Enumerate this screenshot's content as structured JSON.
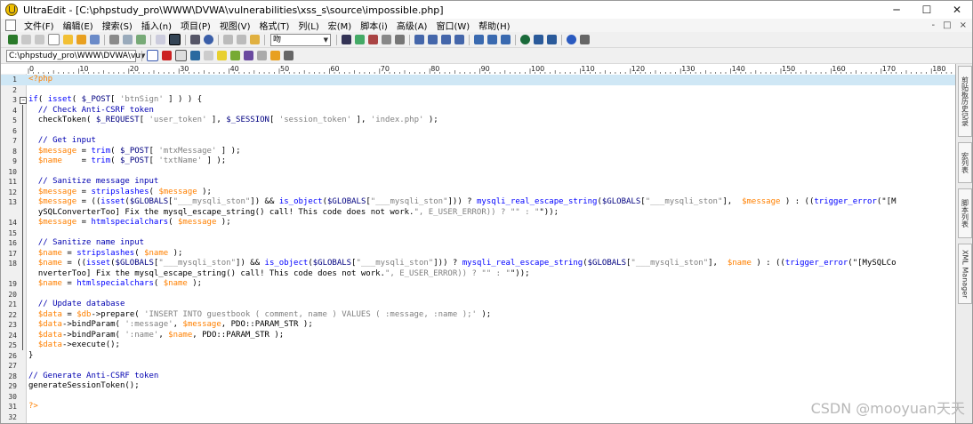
{
  "window": {
    "title": "UltraEdit - [C:\\phpstudy_pro\\WWW\\DVWA\\vulnerabilities\\xss_s\\source\\impossible.php]"
  },
  "menu": {
    "items": [
      "文件(F)",
      "编辑(E)",
      "搜索(S)",
      "插入(n)",
      "项目(P)",
      "视图(V)",
      "格式(T)",
      "列(L)",
      "宏(M)",
      "脚本(i)",
      "高级(A)",
      "窗口(W)",
      "帮助(H)"
    ],
    "right_controls": [
      "-",
      "□",
      "×"
    ]
  },
  "toolbar": {
    "font_combo": "吻"
  },
  "toolbar2": {
    "path_combo": "C:\\phpstudy_pro\\WWW\\DVWA\\vu"
  },
  "ruler": {
    "marks": [
      "0",
      "10",
      "20",
      "30",
      "40",
      "50",
      "60",
      "70",
      "80",
      "90",
      "100",
      "110",
      "120",
      "130",
      "140",
      "150",
      "160",
      "170",
      "180"
    ]
  },
  "side_tabs": [
    "剪贴板历史记录",
    "宏列表",
    "脚本列表",
    "XML Manager"
  ],
  "watermark": "CSDN @mooyuan天天",
  "code": {
    "lines": [
      {
        "n": "1",
        "text": "<?php"
      },
      {
        "n": "2",
        "text": ""
      },
      {
        "n": "3",
        "text": "if( isset( $_POST[ 'btnSign' ] ) ) {"
      },
      {
        "n": "4",
        "text": "  // Check Anti-CSRF token"
      },
      {
        "n": "5",
        "text": "  checkToken( $_REQUEST[ 'user_token' ], $_SESSION[ 'session_token' ], 'index.php' );"
      },
      {
        "n": "6",
        "text": ""
      },
      {
        "n": "7",
        "text": "  // Get input"
      },
      {
        "n": "8",
        "text": "  $message = trim( $_POST[ 'mtxMessage' ] );"
      },
      {
        "n": "9",
        "text": "  $name    = trim( $_POST[ 'txtName' ] );"
      },
      {
        "n": "10",
        "text": ""
      },
      {
        "n": "11",
        "text": "  // Sanitize message input"
      },
      {
        "n": "12",
        "text": "  $message = stripslashes( $message );"
      },
      {
        "n": "13",
        "text": "  $message = ((isset($GLOBALS[\"___mysqli_ston\"]) && is_object($GLOBALS[\"___mysqli_ston\"])) ? mysqli_real_escape_string($GLOBALS[\"___mysqli_ston\"],  $message ) : ((trigger_error(\"[M"
      },
      {
        "n": "",
        "text": "  ySQLConverterToo] Fix the mysql_escape_string() call! This code does not work.\", E_USER_ERROR)) ? \"\" : \"\"));"
      },
      {
        "n": "14",
        "text": "  $message = htmlspecialchars( $message );"
      },
      {
        "n": "15",
        "text": ""
      },
      {
        "n": "16",
        "text": "  // Sanitize name input"
      },
      {
        "n": "17",
        "text": "  $name = stripslashes( $name );"
      },
      {
        "n": "18",
        "text": "  $name = ((isset($GLOBALS[\"___mysqli_ston\"]) && is_object($GLOBALS[\"___mysqli_ston\"])) ? mysqli_real_escape_string($GLOBALS[\"___mysqli_ston\"],  $name ) : ((trigger_error(\"[MySQLCo"
      },
      {
        "n": "",
        "text": "  nverterToo] Fix the mysql_escape_string() call! This code does not work.\", E_USER_ERROR)) ? \"\" : \"\"));"
      },
      {
        "n": "19",
        "text": "  $name = htmlspecialchars( $name );"
      },
      {
        "n": "20",
        "text": ""
      },
      {
        "n": "21",
        "text": "  // Update database"
      },
      {
        "n": "22",
        "text": "  $data = $db->prepare( 'INSERT INTO guestbook ( comment, name ) VALUES ( :message, :name );' );"
      },
      {
        "n": "23",
        "text": "  $data->bindParam( ':message', $message, PDO::PARAM_STR );"
      },
      {
        "n": "24",
        "text": "  $data->bindParam( ':name', $name, PDO::PARAM_STR );"
      },
      {
        "n": "25",
        "text": "  $data->execute();"
      },
      {
        "n": "26",
        "text": "}"
      },
      {
        "n": "27",
        "text": ""
      },
      {
        "n": "28",
        "text": "// Generate Anti-CSRF token"
      },
      {
        "n": "29",
        "text": "generateSessionToken();"
      },
      {
        "n": "30",
        "text": ""
      },
      {
        "n": "31",
        "text": "?>"
      },
      {
        "n": "32",
        "text": ""
      }
    ]
  }
}
